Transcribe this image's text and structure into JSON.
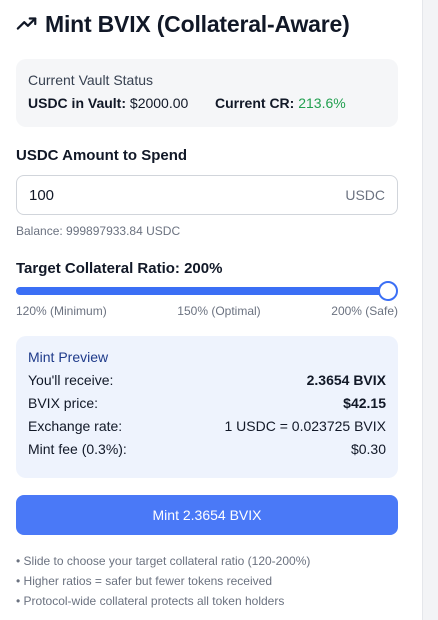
{
  "header": {
    "title": "Mint BVIX (Collateral-Aware)",
    "icon": "trending-up-icon"
  },
  "vault": {
    "heading": "Current Vault Status",
    "usdc_label": "USDC in Vault:",
    "usdc_value": "$2000.00",
    "cr_label": "Current CR:",
    "cr_value": "213.6%",
    "cr_color": "#22a050"
  },
  "amount": {
    "label": "USDC Amount to Spend",
    "value": "100",
    "unit": "USDC",
    "balance": "Balance: 999897933.84 USDC"
  },
  "ratio": {
    "label": "Target Collateral Ratio: 200%",
    "value_percent": 200,
    "min_percent": 120,
    "max_percent": 200,
    "tick_min": "120% (Minimum)",
    "tick_mid": "150% (Optimal)",
    "tick_max": "200% (Safe)"
  },
  "preview": {
    "heading": "Mint Preview",
    "rows": [
      {
        "label": "You'll receive:",
        "value": "2.3654 BVIX"
      },
      {
        "label": "BVIX price:",
        "value": "$42.15"
      },
      {
        "label": "Exchange rate:",
        "value": "1 USDC = 0.023725 BVIX"
      },
      {
        "label": "Mint fee (0.3%):",
        "value": "$0.30"
      }
    ]
  },
  "action": {
    "mint_label": "Mint 2.3654 BVIX",
    "color": "#4a79f7"
  },
  "notes": [
    "• Slide to choose your target collateral ratio (120-200%)",
    "• Higher ratios = safer but fewer tokens received",
    "• Protocol-wide collateral protects all token holders"
  ]
}
